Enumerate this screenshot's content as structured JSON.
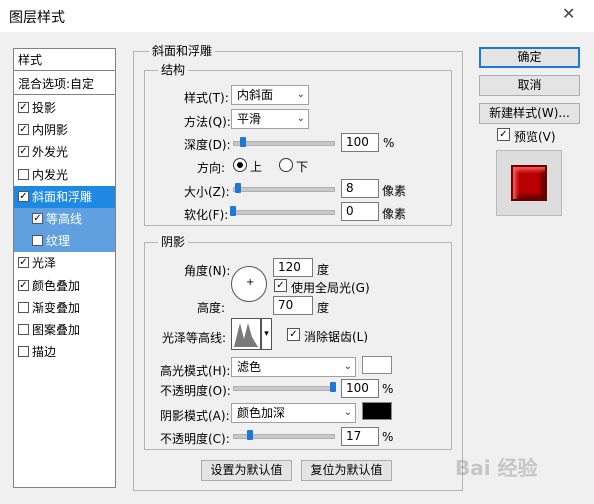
{
  "window": {
    "title": "图层样式",
    "close_glyph": "✕"
  },
  "styles_panel": {
    "header": "样式",
    "blend_options": "混合选项:自定",
    "items": [
      {
        "label": "投影",
        "checked": true
      },
      {
        "label": "内阴影",
        "checked": true
      },
      {
        "label": "外发光",
        "checked": true
      },
      {
        "label": "内发光",
        "checked": false
      },
      {
        "label": "斜面和浮雕",
        "checked": true,
        "selected": true
      },
      {
        "label": "等高线",
        "checked": true
      },
      {
        "label": "纹理",
        "checked": false
      },
      {
        "label": "光泽",
        "checked": true
      },
      {
        "label": "颜色叠加",
        "checked": true
      },
      {
        "label": "渐变叠加",
        "checked": false
      },
      {
        "label": "图案叠加",
        "checked": false
      },
      {
        "label": "描边",
        "checked": false
      }
    ]
  },
  "bevel": {
    "title": "斜面和浮雕",
    "structure": {
      "title": "结构",
      "style_label": "样式(T):",
      "style_value": "内斜面",
      "technique_label": "方法(Q):",
      "technique_value": "平滑",
      "depth_label": "深度(D):",
      "depth_value": "100",
      "depth_unit": "%",
      "depth_level": 0.1,
      "direction_label": "方向:",
      "dir_up": "上",
      "dir_down": "下",
      "size_label": "大小(Z):",
      "size_value": "8",
      "size_unit": "像素",
      "size_level": 0.05,
      "soften_label": "软化(F):",
      "soften_value": "0",
      "soften_unit": "像素",
      "soften_level": 0.0
    },
    "shading": {
      "title": "阴影",
      "angle_label": "角度(N):",
      "angle_value": "120",
      "angle_unit": "度",
      "global_light": "使用全局光(G)",
      "altitude_label": "高度:",
      "altitude_value": "70",
      "altitude_unit": "度",
      "gloss_label": "光泽等高线:",
      "antialias": "消除锯齿(L)",
      "highlight_mode_label": "高光模式(H):",
      "highlight_mode": "滤色",
      "highlight_color": "#ffffff",
      "highlight_opacity_label": "不透明度(O):",
      "highlight_opacity": "100",
      "highlight_opacity_unit": "%",
      "highlight_opacity_level": 1.0,
      "shadow_mode_label": "阴影模式(A):",
      "shadow_mode": "颜色加深",
      "shadow_color": "#000000",
      "shadow_opacity_label": "不透明度(C):",
      "shadow_opacity": "17",
      "shadow_opacity_unit": "%",
      "shadow_opacity_level": 0.17
    },
    "make_default": "设置为默认值",
    "reset_default": "复位为默认值"
  },
  "right": {
    "ok": "确定",
    "cancel": "取消",
    "new_style": "新建样式(W)...",
    "preview": "预览(V)"
  },
  "watermark": "Bai 经验"
}
